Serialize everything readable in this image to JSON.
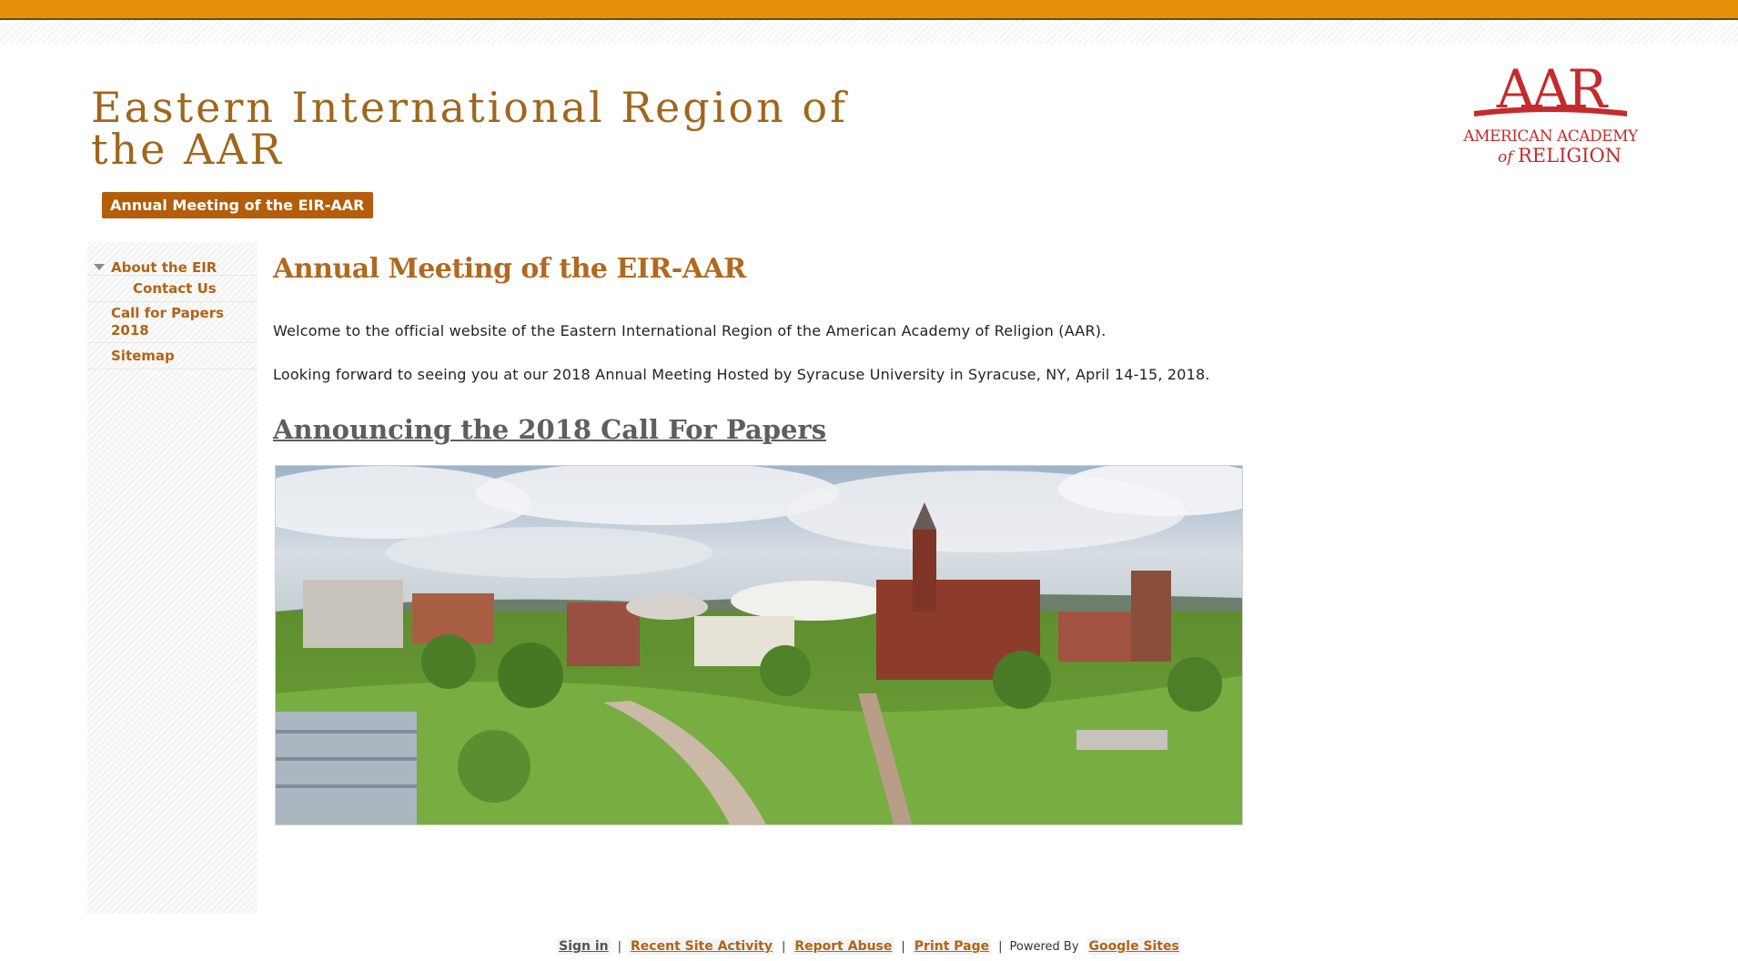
{
  "header": {
    "site_title": "Eastern International Region of the AAR",
    "tab_label": "Annual Meeting of the EIR-AAR",
    "logo": {
      "line1": "AAR",
      "line2": "AMERICAN ACADEMY",
      "line3_of": "of",
      "line3": "RELIGION",
      "color": "#c42b2b"
    }
  },
  "sidebar": {
    "items": [
      {
        "label": "About the EIR",
        "expanded": true
      },
      {
        "label": "Contact Us"
      },
      {
        "label": "Call for Papers 2018"
      },
      {
        "label": "Sitemap"
      }
    ]
  },
  "main": {
    "title": "Annual Meeting of the EIR-AAR",
    "welcome": "Welcome to the official website of the Eastern International Region of the American Academy of Religion (AAR).",
    "looking_forward": "Looking forward to seeing you at our 2018 Annual Meeting Hosted by Syracuse University in Syracuse, NY, April 14-15, 2018.",
    "announcement_link": "Announcing the 2018 Call For Papers"
  },
  "footer": {
    "sign_in": "Sign in",
    "recent_activity": "Recent Site Activity",
    "report_abuse": "Report Abuse",
    "print_page": "Print Page",
    "powered_by": "Powered By",
    "google_sites": "Google Sites",
    "separator": "|"
  },
  "colors": {
    "accent": "#e6900a",
    "title": "#a0661b",
    "tab": "#b45d0b",
    "nav_link": "#b06416"
  }
}
